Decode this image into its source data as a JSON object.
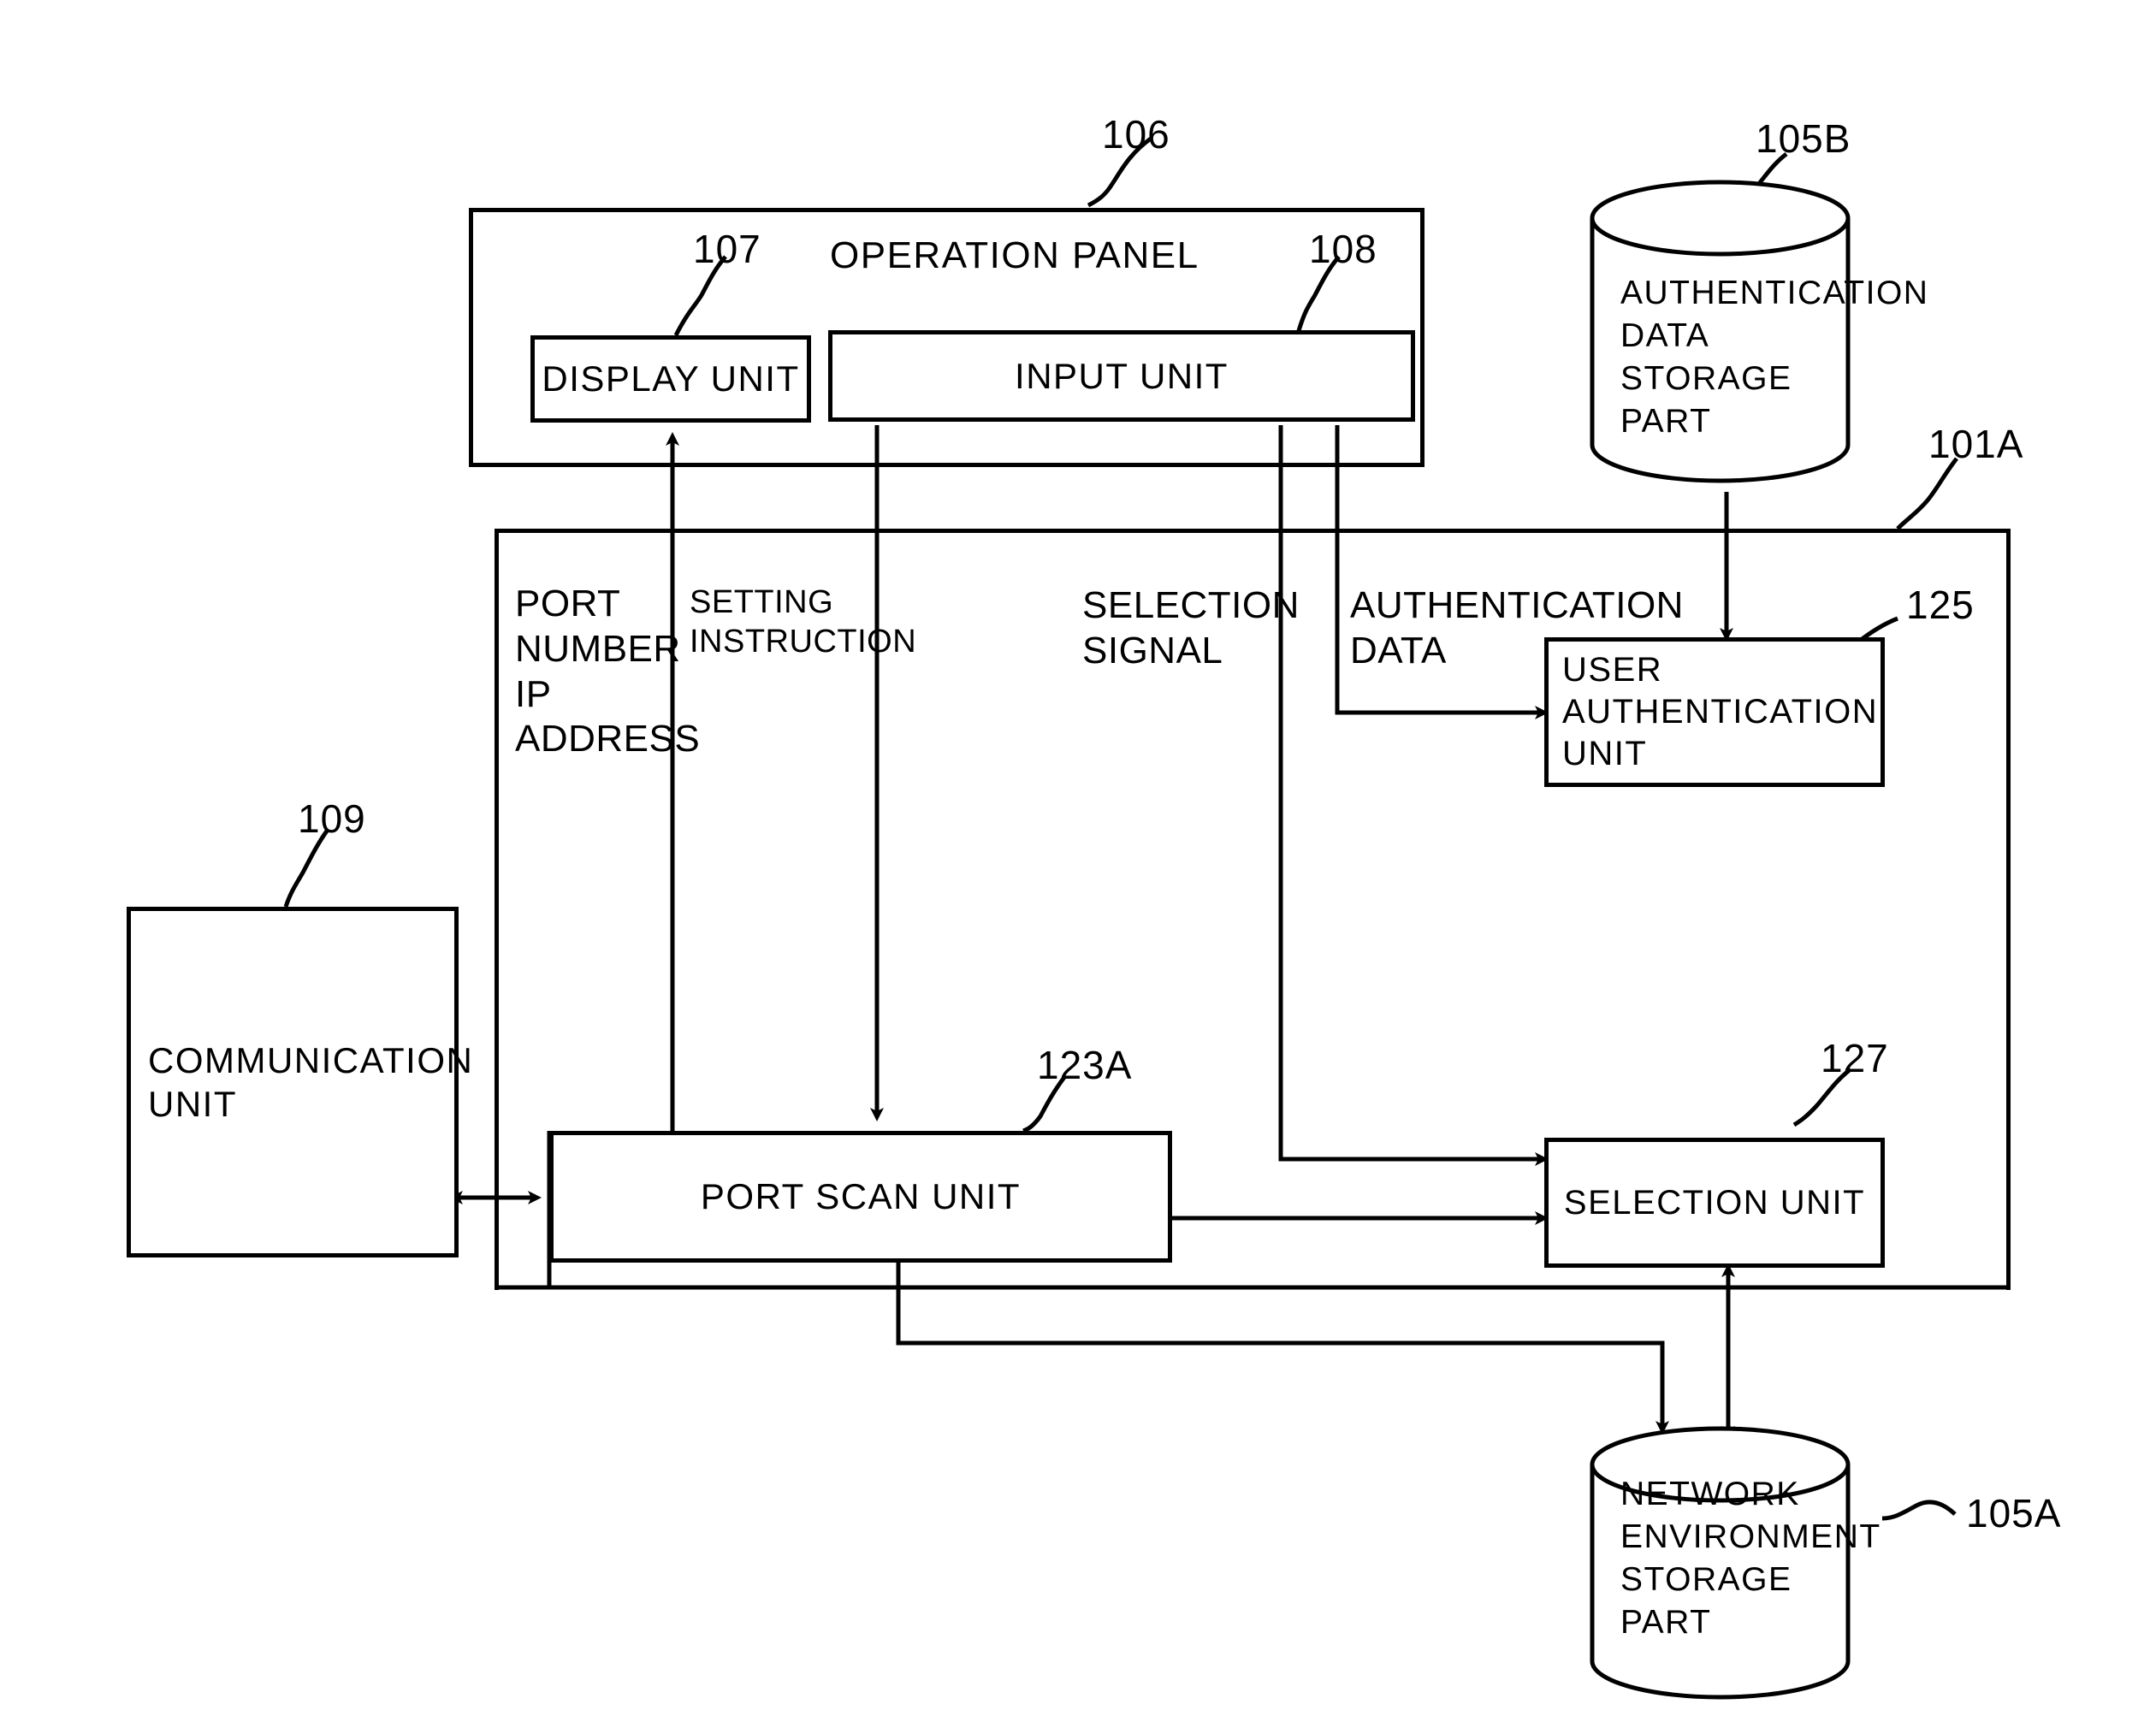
{
  "figure": {
    "type": "patent-block-diagram",
    "background_color": "#ffffff",
    "line_color": "#000000"
  },
  "blocks": {
    "operation_panel": {
      "label": "OPERATION PANEL",
      "ref": "106"
    },
    "display_unit": {
      "label": "DISPLAY UNIT",
      "ref": "107"
    },
    "input_unit": {
      "label": "INPUT UNIT",
      "ref": "108"
    },
    "communication_unit": {
      "label": "COMMUNICATION\nUNIT",
      "ref": "109"
    },
    "port_scan_unit": {
      "label": "PORT SCAN UNIT",
      "ref": "123A"
    },
    "user_auth_unit": {
      "label": "USER\nAUTHENTICATION\nUNIT",
      "ref": "125"
    },
    "selection_unit": {
      "label": "SELECTION UNIT",
      "ref": "127"
    },
    "main_device": {
      "ref": "101A"
    },
    "auth_data_storage": {
      "label": "AUTHENTICATION\nDATA\nSTORAGE\nPART",
      "ref": "105B"
    },
    "network_env_storage": {
      "label": "NETWORK\nENVIRONMENT\nSTORAGE\nPART",
      "ref": "105A"
    }
  },
  "signals": {
    "port_number_ip_address": "PORT\nNUMBER\nIP\nADDRESS",
    "setting_instruction": "SETTING\nINSTRUCTION",
    "selection_signal": "SELECTION\nSIGNAL",
    "authentication_data": "AUTHENTICATION\nDATA"
  },
  "reference_numerals": {
    "operation_panel": "106",
    "display_unit": "107",
    "input_unit": "108",
    "communication_unit": "109",
    "port_scan_unit": "123A",
    "user_auth_unit": "125",
    "selection_unit": "127",
    "main_device": "101A",
    "auth_data_storage": "105B",
    "network_env_storage": "105A"
  }
}
